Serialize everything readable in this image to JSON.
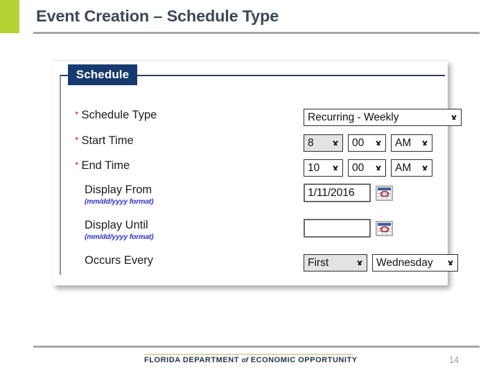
{
  "slide": {
    "title": "Event Creation – Schedule Type",
    "page_number": "14",
    "accent_green": "#b5d334",
    "title_color": "#3b4856",
    "rule_color": "#a6a6a6"
  },
  "panel": {
    "legend": "Schedule",
    "legend_bg": "#173a6e",
    "border_color": "#2b3f55"
  },
  "form": {
    "required_marker": "*",
    "rows": [
      {
        "label": "Schedule Type",
        "required": true,
        "hint": "",
        "controls": [
          {
            "type": "select",
            "name": "schedule-type",
            "value": "Recurring - Weekly",
            "style": "white"
          }
        ]
      },
      {
        "label": "Start Time",
        "required": true,
        "hint": "",
        "controls": [
          {
            "type": "select",
            "name": "start-hour",
            "value": "8",
            "style": "gray"
          },
          {
            "type": "select",
            "name": "start-minute",
            "value": "00",
            "style": "white"
          },
          {
            "type": "select",
            "name": "start-ampm",
            "value": "AM",
            "style": "white"
          }
        ]
      },
      {
        "label": "End Time",
        "required": true,
        "hint": "",
        "controls": [
          {
            "type": "select",
            "name": "end-hour",
            "value": "10",
            "style": "white"
          },
          {
            "type": "select",
            "name": "end-minute",
            "value": "00",
            "style": "white"
          },
          {
            "type": "select",
            "name": "end-ampm",
            "value": "AM",
            "style": "white"
          }
        ]
      },
      {
        "label": "Display From",
        "required": false,
        "hint": "(mm/dd/yyyy format)",
        "controls": [
          {
            "type": "text",
            "name": "display-from",
            "value": "1/11/2016",
            "placeholder": ""
          },
          {
            "type": "calendar-button",
            "name": "display-from-calendar"
          }
        ]
      },
      {
        "label": "Display Until",
        "required": false,
        "hint": "(mm/dd/yyyy format)",
        "controls": [
          {
            "type": "text",
            "name": "display-until",
            "value": "",
            "placeholder": ""
          },
          {
            "type": "calendar-button",
            "name": "display-until-calendar"
          }
        ]
      },
      {
        "label": "Occurs Every",
        "required": false,
        "hint": "",
        "controls": [
          {
            "type": "select",
            "name": "occurs-ordinal",
            "value": "First",
            "style": "gray"
          },
          {
            "type": "select",
            "name": "occurs-weekday",
            "value": "Wednesday",
            "style": "white"
          }
        ]
      }
    ],
    "hint_color": "#2d32c8",
    "required_color": "#c0392b"
  },
  "footer": {
    "org_part1": "FLORIDA DEPARTMENT",
    "org_of": "of",
    "org_part2": "ECONOMIC OPPORTUNITY",
    "gold_line_color": "#c8b06a",
    "org_color": "#1e3349"
  }
}
